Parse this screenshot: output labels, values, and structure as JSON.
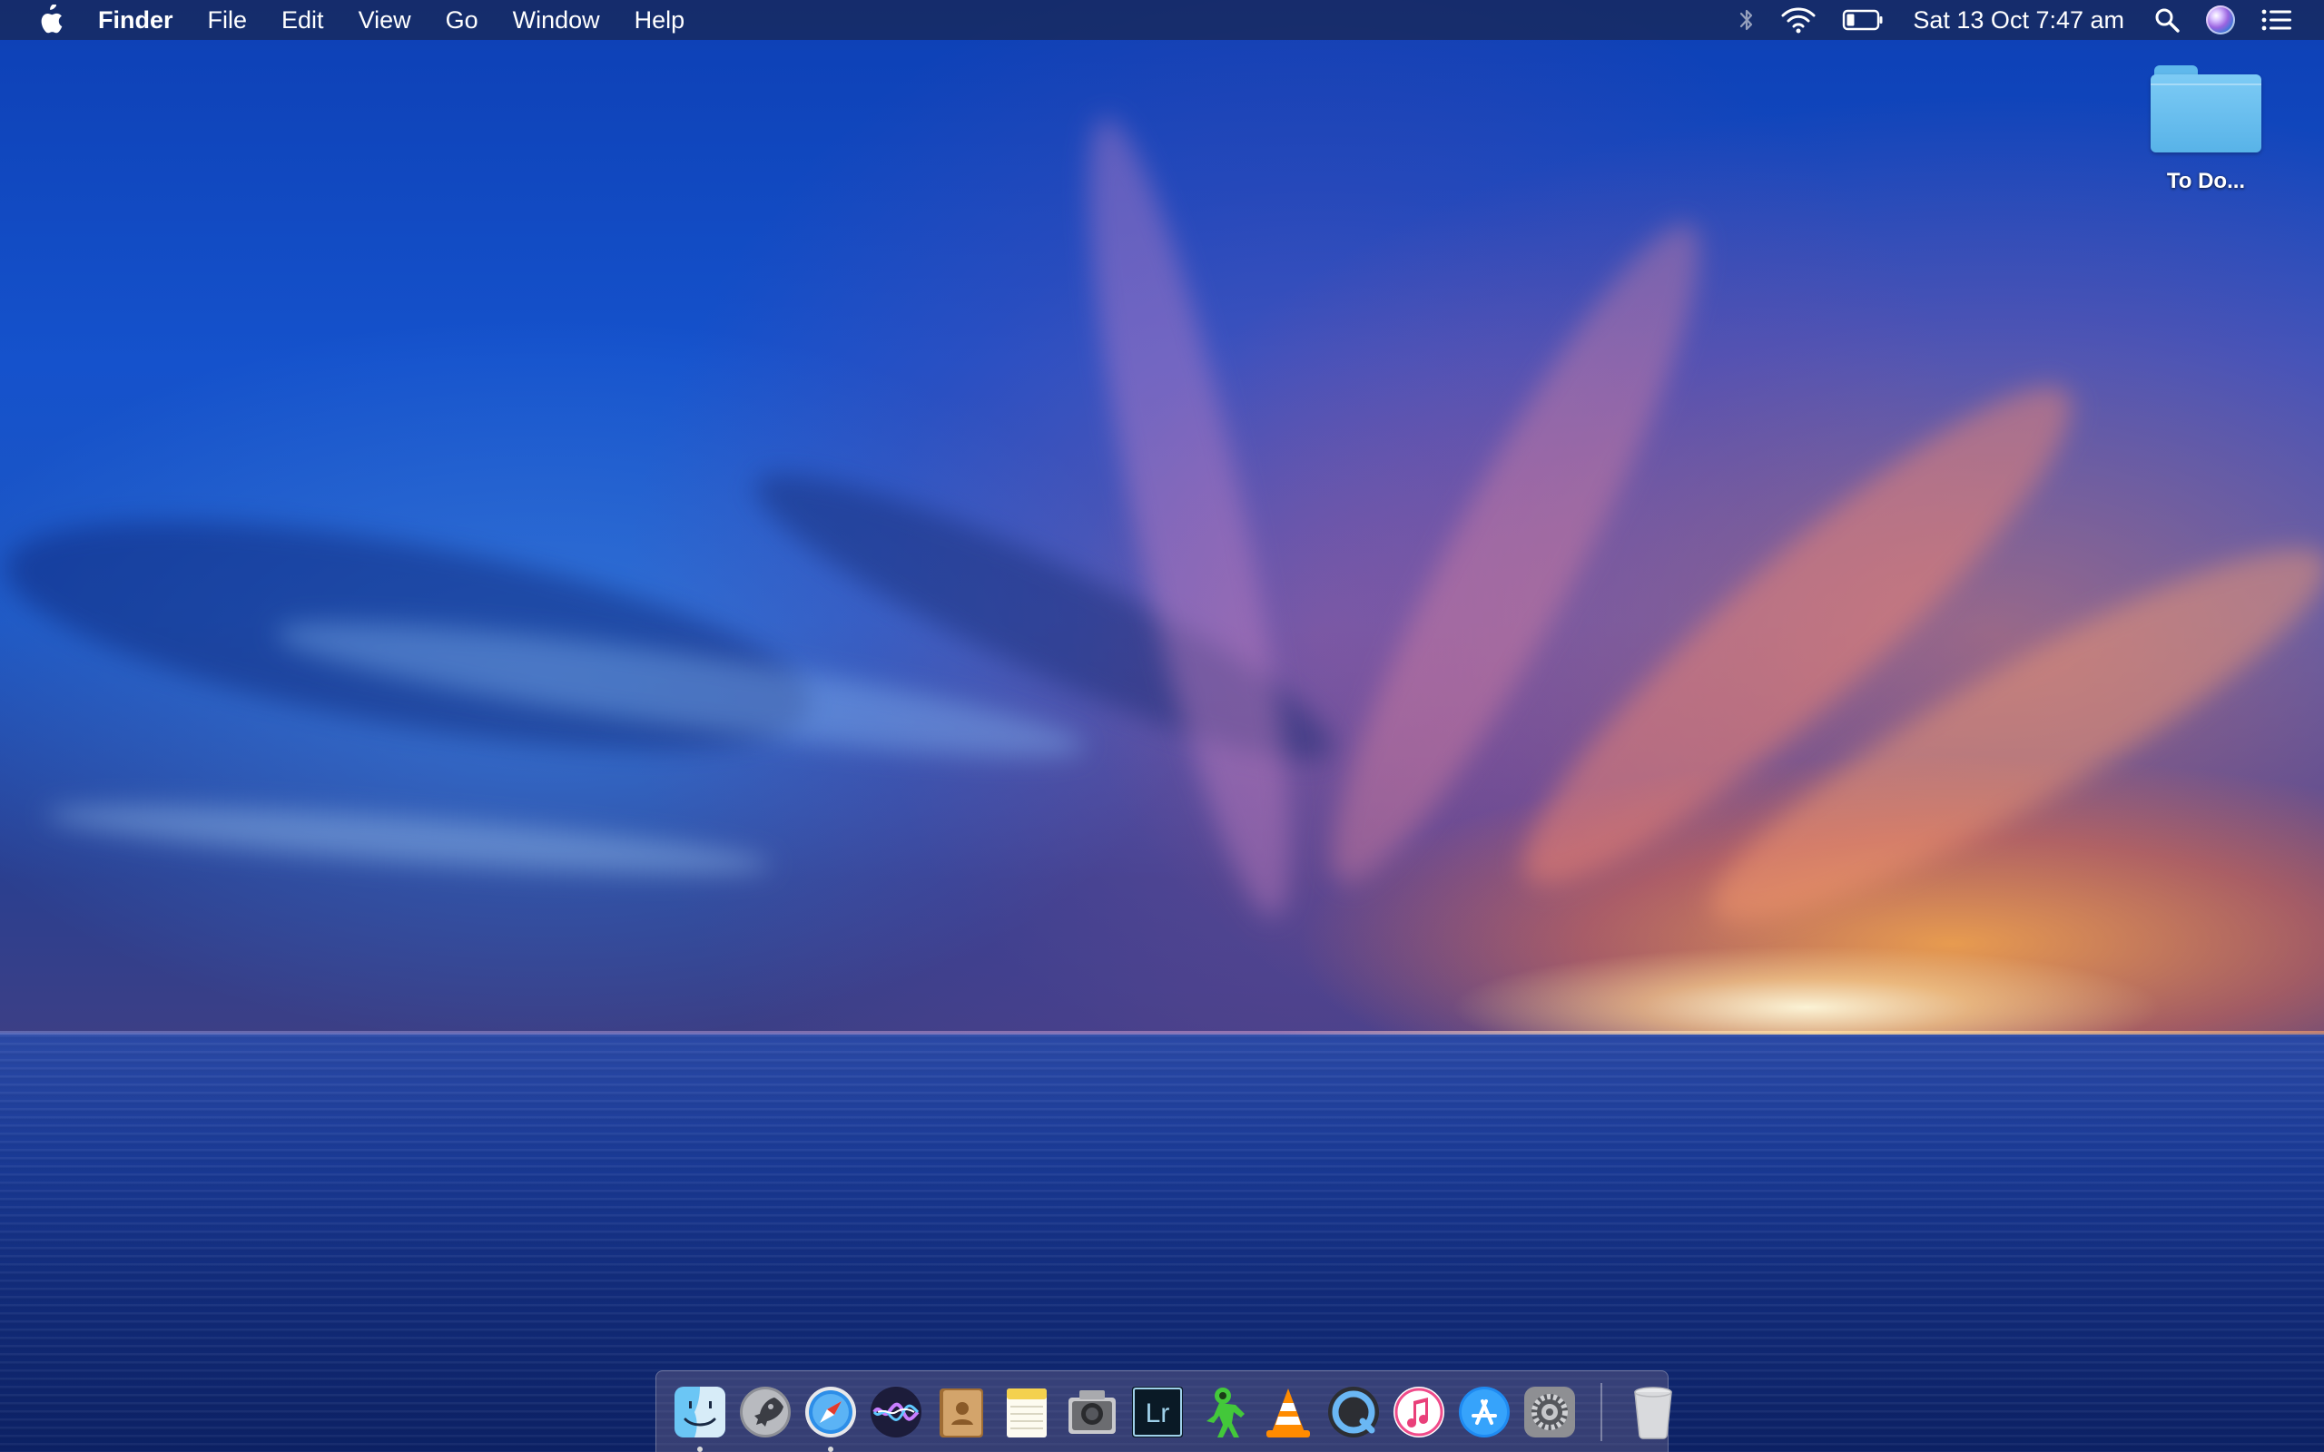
{
  "menubar": {
    "app_name": "Finder",
    "menus": [
      "File",
      "Edit",
      "View",
      "Go",
      "Window",
      "Help"
    ],
    "status_icons": [
      "bluetooth-icon",
      "wifi-icon",
      "battery-icon",
      "spotlight-icon",
      "siri-icon",
      "notification-center-icon"
    ],
    "clock": "Sat 13 Oct  7:47 am"
  },
  "desktop": {
    "items": [
      {
        "label": "To Do...",
        "icon": "folder-icon"
      }
    ]
  },
  "dock": {
    "apps": [
      {
        "name": "finder",
        "icon": "finder-icon",
        "running": true
      },
      {
        "name": "launchpad",
        "icon": "launchpad-icon",
        "running": false
      },
      {
        "name": "safari",
        "icon": "safari-icon",
        "running": true
      },
      {
        "name": "siri",
        "icon": "siri-icon",
        "running": false
      },
      {
        "name": "contacts",
        "icon": "contacts-icon",
        "running": false
      },
      {
        "name": "notes",
        "icon": "notes-icon",
        "running": false
      },
      {
        "name": "photo-booth",
        "icon": "photo-booth-icon",
        "running": false
      },
      {
        "name": "lightroom",
        "icon": "lightroom-icon",
        "label": "Lr",
        "running": false
      },
      {
        "name": "green-alien",
        "icon": "alien-icon",
        "running": false
      },
      {
        "name": "vlc",
        "icon": "vlc-icon",
        "running": false
      },
      {
        "name": "quicktime",
        "icon": "quicktime-icon",
        "running": false
      },
      {
        "name": "itunes",
        "icon": "itunes-icon",
        "running": false
      },
      {
        "name": "app-store",
        "icon": "app-store-icon",
        "running": false
      },
      {
        "name": "system-preferences",
        "icon": "system-preferences-icon",
        "running": false
      },
      {
        "name": "trash",
        "icon": "trash-icon",
        "running": false
      }
    ]
  },
  "colors": {
    "menubar": "#1c2850",
    "folder": "#6cc2f2",
    "dock": "#7a6e8c"
  }
}
